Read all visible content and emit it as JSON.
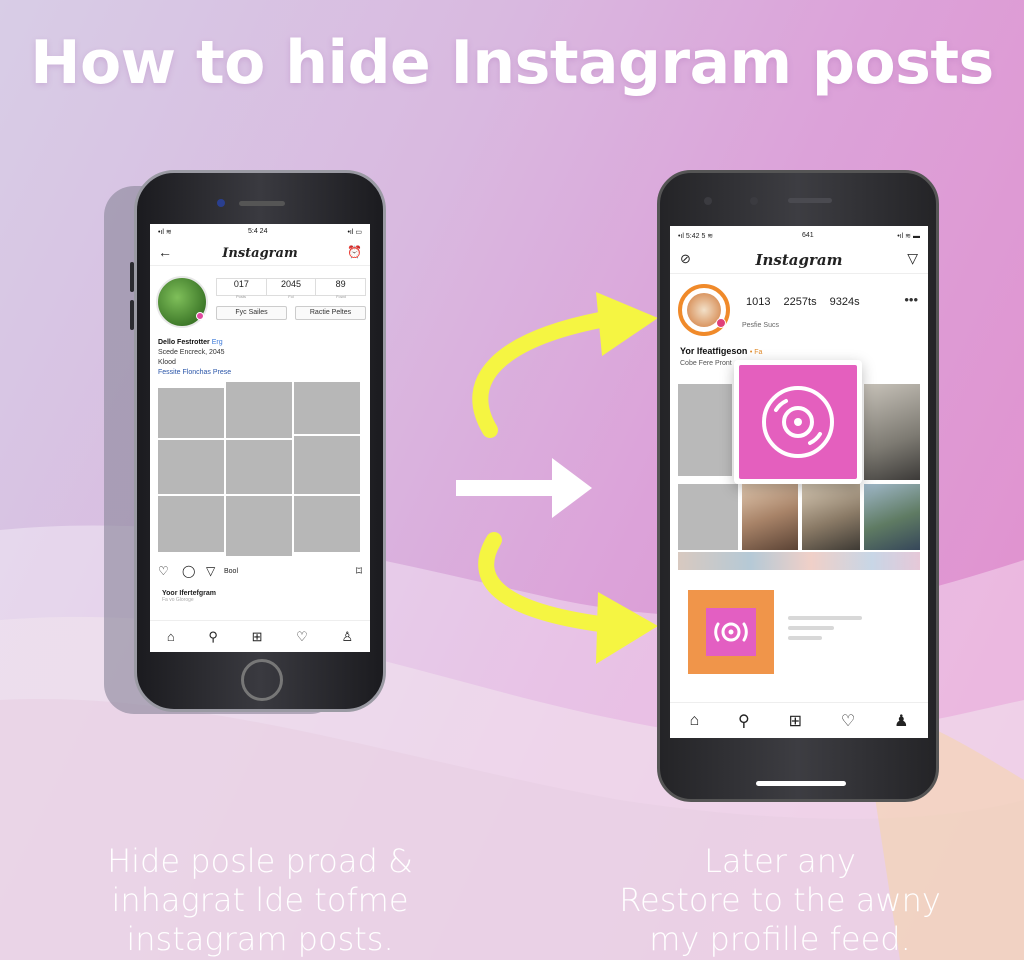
{
  "headline": "How to hide Instagram posts",
  "colors": {
    "arrow_yellow": "#f5f542",
    "accent_pink": "#e45fbe",
    "accent_orange": "#f0954a"
  },
  "left_phone": {
    "status": {
      "signal": "•ıl ≋",
      "time": "5:4 24",
      "battery": "•ıl ▭"
    },
    "nav": {
      "back_icon": "←",
      "title": "Instagram",
      "alarm_icon": "⏰"
    },
    "stats": [
      "017",
      "2045",
      "89"
    ],
    "stat_labels": [
      "Posts",
      "Fol",
      "Fowd"
    ],
    "buttons": [
      "Fyc Sailes",
      "Ractie Peltes"
    ],
    "bio": {
      "name": "Dello Festrotter",
      "tag": "Erg",
      "line2": "Scede Encreck, 2045",
      "line3": "Klood",
      "link": "Fessite Flonchas Prese"
    },
    "actions": {
      "like": "♡",
      "comment": "◯",
      "share": "▽",
      "extra": "Bool",
      "save": "⌑"
    },
    "comment": {
      "name": "Yoor Ifertefgram",
      "sub": "Fa vo Gloroge"
    },
    "tabbar": [
      "⌂",
      "⚲",
      "⊞",
      "♡",
      "♙"
    ]
  },
  "right_phone": {
    "status": {
      "left": "•ıl 5:42 5 ≋",
      "time": "641",
      "right": "•ıl ≋ ▬"
    },
    "nav": {
      "left_icon": "⊘",
      "title": "Instagram",
      "right_icon": "▽"
    },
    "stats": [
      "1013",
      "2257ts",
      "9324s"
    ],
    "more": "•••",
    "edit": "Pesfie Sucs",
    "bio": {
      "name": "Yor Ifeatfigeson",
      "tag": "• Fa",
      "sub": "Cobe Fere Pront"
    },
    "tabbar": [
      "⌂",
      "⚲",
      "⊞",
      "♡",
      "♟"
    ]
  },
  "caption_left": [
    "Hide posle proad &",
    "inhagrat lde tofme",
    "instagram posts."
  ],
  "caption_right": [
    "Later any",
    "Restore to the awny",
    "my profille feed."
  ]
}
